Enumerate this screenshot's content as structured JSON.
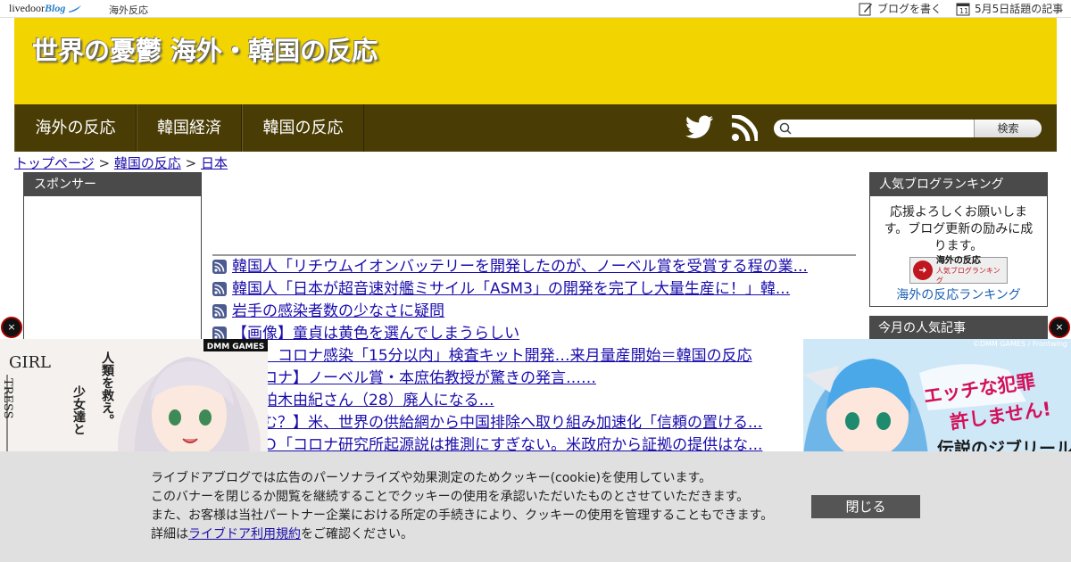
{
  "topbar": {
    "logo_main": "livedoor",
    "logo_blog": "Blog",
    "site_name": "海外反応",
    "write_label": "ブログを書く",
    "topic_label": "5月5日話題の記事"
  },
  "header": {
    "title": "世界の憂鬱 海外・韓国の反応",
    "background": "#f2d500"
  },
  "nav": {
    "items": [
      {
        "label": "海外の反応"
      },
      {
        "label": "韓国経済"
      },
      {
        "label": "韓国の反応"
      }
    ],
    "search_button": "検索",
    "search_placeholder": "",
    "background": "#4a3c05"
  },
  "breadcrumb": {
    "home": "トップページ",
    "sep1": ">",
    "category": "韓国の反応",
    "sep2": ">",
    "current": "日本"
  },
  "sponsor": {
    "heading": "スポンサー"
  },
  "ranking": {
    "heading": "人気ブログランキング",
    "message": "応援よろしくお願いします。ブログ更新の励みに成ります。",
    "banner_title": "海外の反応",
    "banner_sub": "人気ブログランキング",
    "link": "海外の反応ランキング",
    "popular_heading": "今月の人気記事"
  },
  "articles": [
    "韓国人「リチウムイオンバッテリーを開発したのが、ノーベル賞を受賞する程の業...",
    "韓国人「日本が超音速対艦ミサイル「ASM3」の開発を完了し大量生産に！」韓...",
    "岩手の感染者数の少なさに疑問",
    "【画像】童貞は黄色を選んでしまうらしい",
    "企業、コロナ感染「15分以内」検査キット開発…来月量産開始＝韓国の反応",
    "型コロナ】ノーベル賞・本庶佑教授が驚きの発言……",
    "報】柏木由紀さん（28）廃人になる…",
    "国含む？】米、世界の供給網から中国排除へ取り組み加速化「信頼の置ける...",
    "ＷＨＯ「コロナ研究所起源説は推測にすぎない。米政府から証拠の提供はな..."
  ],
  "ads": {
    "left": {
      "brand": "DMM GAMES",
      "title": "GIRL",
      "side": "TRESS",
      "text1": "人類を救え。",
      "text2": "少女達と"
    },
    "right": {
      "credit": "©DMM GAMES / Frontwing",
      "text1": "エッチな犯罪",
      "text2": "許しません!",
      "text3": "伝説のジブリール"
    },
    "close_symbol": "×"
  },
  "cookie": {
    "line1": "ライブドアブログでは広告のパーソナライズや効果測定のためクッキー(cookie)を使用しています。",
    "line2": "このバナーを閉じるか閲覧を継続することでクッキーの使用を承認いただいたものとさせていただきます。",
    "line3": "また、お客様は当社パートナー企業における所定の手続きにより、クッキーの使用を管理することもできます。",
    "line4_prefix": "詳細は",
    "line4_link": "ライブドア利用規約",
    "line4_suffix": "をご確認ください。",
    "close_label": "閉じる"
  }
}
